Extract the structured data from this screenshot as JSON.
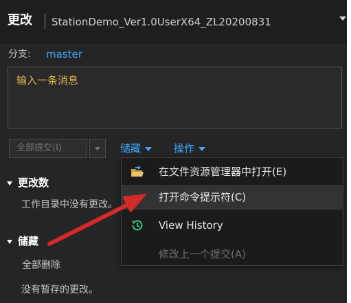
{
  "header": {
    "title": "更改",
    "repo_name": "StationDemo_Ver1.0UserX64_ZL20200831"
  },
  "branch": {
    "label": "分支:",
    "name": "master"
  },
  "message": {
    "placeholder": "输入一条消息"
  },
  "commit": {
    "commit_all_label": "全部提交(I)"
  },
  "links": {
    "stash": "储藏",
    "actions": "操作"
  },
  "sections": {
    "changes": {
      "title": "更改数",
      "empty_text": "工作目录中没有更改。"
    },
    "stashes": {
      "title": "储藏",
      "delete_all": "全部删除",
      "empty_text": "没有暂存的更改。"
    }
  },
  "menu": {
    "items": [
      {
        "label": "在文件资源管理器中打开(E)",
        "icon": "folder-open-icon",
        "enabled": true
      },
      {
        "label": "打开命令提示符(C)",
        "icon": "",
        "enabled": true,
        "hovered": true
      },
      {
        "label": "View History",
        "icon": "history-icon",
        "enabled": true
      },
      {
        "label": "修改上一个提交(A)",
        "icon": "",
        "enabled": false
      }
    ]
  },
  "colors": {
    "link": "#3ea6ff",
    "placeholder": "#e6b84d",
    "annotation_arrow": "#d42a2a",
    "history_icon": "#3cc47c"
  }
}
